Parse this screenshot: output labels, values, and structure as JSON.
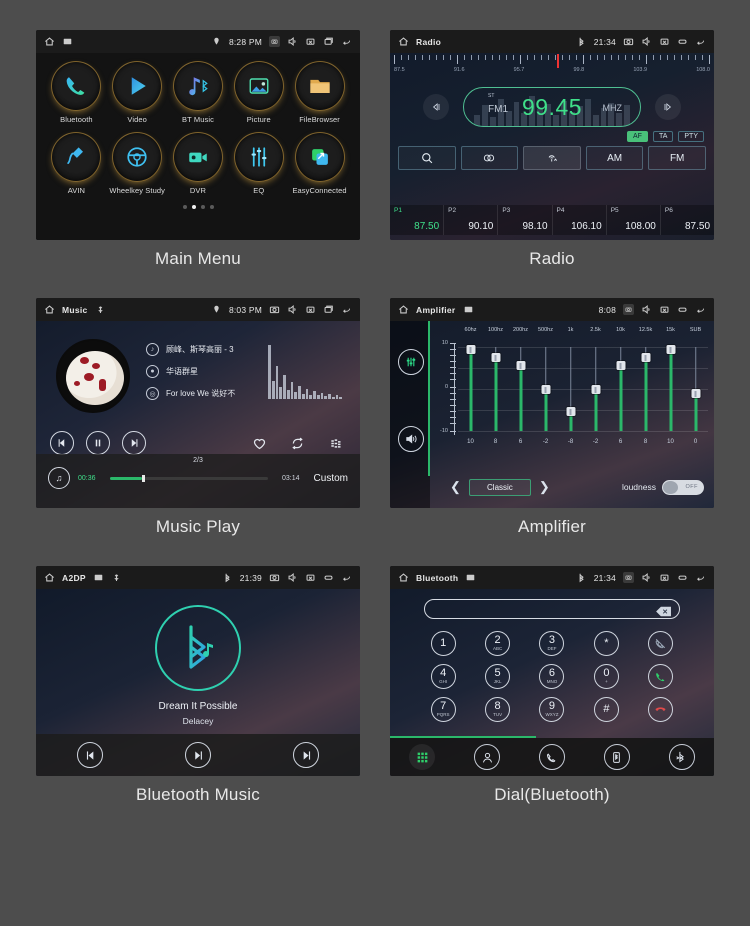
{
  "page": {
    "background": "#4d4d4d"
  },
  "panels": [
    {
      "caption": "Main Menu",
      "statusbar": {
        "title": "",
        "icons_left": [
          "home-icon",
          "sdcard-icon"
        ],
        "location": "location-icon",
        "time": "8:28 PM",
        "icons_right": [
          "screenshot-icon",
          "volume-icon",
          "close-icon",
          "recents-icon",
          "back-icon"
        ]
      },
      "apps_row1": [
        {
          "label": "Bluetooth",
          "icon": "phone-icon"
        },
        {
          "label": "Video",
          "icon": "play-icon"
        },
        {
          "label": "BT Music",
          "icon": "music-note-bluetooth-icon"
        },
        {
          "label": "Picture",
          "icon": "image-icon"
        },
        {
          "label": "FileBrowser",
          "icon": "folder-icon"
        }
      ],
      "apps_row2": [
        {
          "label": "AVIN",
          "icon": "aux-plug-icon"
        },
        {
          "label": "Wheelkey Study",
          "icon": "steering-wheel-icon"
        },
        {
          "label": "DVR",
          "icon": "video-camera-icon"
        },
        {
          "label": "EQ",
          "icon": "equalizer-icon"
        },
        {
          "label": "EasyConnected",
          "icon": "mirrorlink-icon"
        }
      ],
      "page_dots": {
        "count": 4,
        "active_index": 1
      }
    },
    {
      "caption": "Radio",
      "statusbar": {
        "title": "Radio",
        "bluetooth": "bluetooth-icon",
        "time": "21:34",
        "icons_right": [
          "screenshot-icon",
          "volume-icon",
          "close-icon",
          "recents-icon",
          "back-icon"
        ]
      },
      "scale_labels": [
        "87.5",
        "91.6",
        "95.7",
        "99.8",
        "103.9",
        "108.0"
      ],
      "needle_percent": 51.5,
      "band": "FM1",
      "stereo_tag": "ST",
      "frequency": "99.45",
      "unit": "MHZ",
      "prev_label": "tune-down-icon",
      "next_label": "tune-up-icon",
      "rds": [
        {
          "label": "AF",
          "active": true
        },
        {
          "label": "TA",
          "active": false
        },
        {
          "label": "PTY",
          "active": false
        }
      ],
      "buttons": [
        {
          "label": "",
          "icon": "search-icon",
          "selected": false
        },
        {
          "label": "",
          "icon": "stereo-icon",
          "selected": false
        },
        {
          "label": "",
          "icon": "antenna-local-icon",
          "selected": true
        },
        {
          "label": "AM",
          "icon": "",
          "selected": false
        },
        {
          "label": "FM",
          "icon": "",
          "selected": false
        }
      ],
      "presets": [
        {
          "name": "P1",
          "freq": "87.50",
          "active": true
        },
        {
          "name": "P2",
          "freq": "90.10",
          "active": false
        },
        {
          "name": "P3",
          "freq": "98.10",
          "active": false
        },
        {
          "name": "P4",
          "freq": "106.10",
          "active": false
        },
        {
          "name": "P5",
          "freq": "108.00",
          "active": false
        },
        {
          "name": "P6",
          "freq": "87.50",
          "active": false
        }
      ]
    },
    {
      "caption": "Music Play",
      "statusbar": {
        "title": "Music",
        "usb": "usb-icon",
        "location": "location-icon",
        "time": "8:03 PM",
        "icons_right": [
          "screenshot-icon",
          "volume-icon",
          "close-icon",
          "recents-icon",
          "back-icon"
        ]
      },
      "track": {
        "title": "顾峰、斯琴高丽 - 3",
        "artist": "华语群星",
        "album": "For love We 说好不",
        "title_icon": "music-note-icon",
        "artist_icon": "person-icon",
        "album_icon": "disc-icon"
      },
      "controls": [
        "previous-icon",
        "pause-icon",
        "next-icon",
        "favorite-icon",
        "repeat-icon",
        "playlist-icon"
      ],
      "page_indicator": "2/3",
      "time_current": "00:36",
      "time_total": "03:14",
      "progress_percent": 20,
      "mode_label": "Custom",
      "eq_badge": "equalizer-badge-icon"
    },
    {
      "caption": "Amplifier",
      "statusbar": {
        "title": "Amplifier",
        "sdcard": "sdcard-icon",
        "time": "8:08",
        "icons_right": [
          "screenshot-icon",
          "volume-icon",
          "close-icon",
          "recents-icon",
          "back-icon"
        ]
      },
      "scale_labels": [
        "10",
        "0",
        "-10"
      ],
      "bands": [
        {
          "freq": "60hz",
          "value": "10"
        },
        {
          "freq": "100hz",
          "value": "8"
        },
        {
          "freq": "200hz",
          "value": "6"
        },
        {
          "freq": "500hz",
          "value": "-2"
        },
        {
          "freq": "1k",
          "value": "-8"
        },
        {
          "freq": "2.5k",
          "value": "-2"
        },
        {
          "freq": "10k",
          "value": "6"
        },
        {
          "freq": "12.5k",
          "value": "8"
        },
        {
          "freq": "15k",
          "value": "10"
        },
        {
          "freq": "SUB",
          "value": "0"
        }
      ],
      "preset_name": "Classic",
      "prev_arrow": "chevron-left-icon",
      "next_arrow": "chevron-right-icon",
      "loudness_label": "loudness",
      "loudness_state": "OFF",
      "side_icons": [
        "equalizer-icon",
        "speaker-icon"
      ]
    },
    {
      "caption": "Bluetooth Music",
      "statusbar": {
        "title": "A2DP",
        "sdcard": "sdcard-icon",
        "usb": "usb-icon",
        "bluetooth": "bluetooth-icon",
        "time": "21:39",
        "icons_right": [
          "screenshot-icon",
          "volume-icon",
          "close-icon",
          "recents-icon",
          "back-icon"
        ]
      },
      "logo_icon": "bluetooth-music-icon",
      "song_title": "Dream It Possible",
      "artist": "Delacey",
      "controls": [
        "previous-icon",
        "play-pause-icon",
        "next-icon"
      ]
    },
    {
      "caption": "Dial(Bluetooth)",
      "statusbar": {
        "title": "Bluetooth",
        "sdcard": "sdcard-icon",
        "bluetooth": "bluetooth-icon",
        "time": "21:34",
        "icons_right": [
          "screenshot-icon",
          "volume-icon",
          "close-icon",
          "recents-icon",
          "back-icon"
        ]
      },
      "number_input": "",
      "delete_icon": "backspace-icon",
      "keys": [
        {
          "digit": "1",
          "sub": ""
        },
        {
          "digit": "2",
          "sub": "ABC"
        },
        {
          "digit": "3",
          "sub": "DEF"
        },
        {
          "digit": "*",
          "sub": ""
        },
        {
          "digit": "",
          "sub": "",
          "icon": "mute-call-icon"
        },
        {
          "digit": "4",
          "sub": "GHI"
        },
        {
          "digit": "5",
          "sub": "JKL"
        },
        {
          "digit": "6",
          "sub": "MNO"
        },
        {
          "digit": "0",
          "sub": "+"
        },
        {
          "digit": "",
          "sub": "",
          "icon": "call-answer-icon"
        },
        {
          "digit": "7",
          "sub": "PQRS"
        },
        {
          "digit": "8",
          "sub": "TUV"
        },
        {
          "digit": "9",
          "sub": "WXYZ"
        },
        {
          "digit": "#",
          "sub": ""
        },
        {
          "digit": "",
          "sub": "",
          "icon": "call-end-icon"
        }
      ],
      "tabs": [
        {
          "icon": "keypad-icon",
          "active": true
        },
        {
          "icon": "contacts-icon",
          "active": false
        },
        {
          "icon": "call-history-icon",
          "active": false
        },
        {
          "icon": "device-icon",
          "active": false
        },
        {
          "icon": "bluetooth-settings-icon",
          "active": false
        }
      ]
    }
  ]
}
